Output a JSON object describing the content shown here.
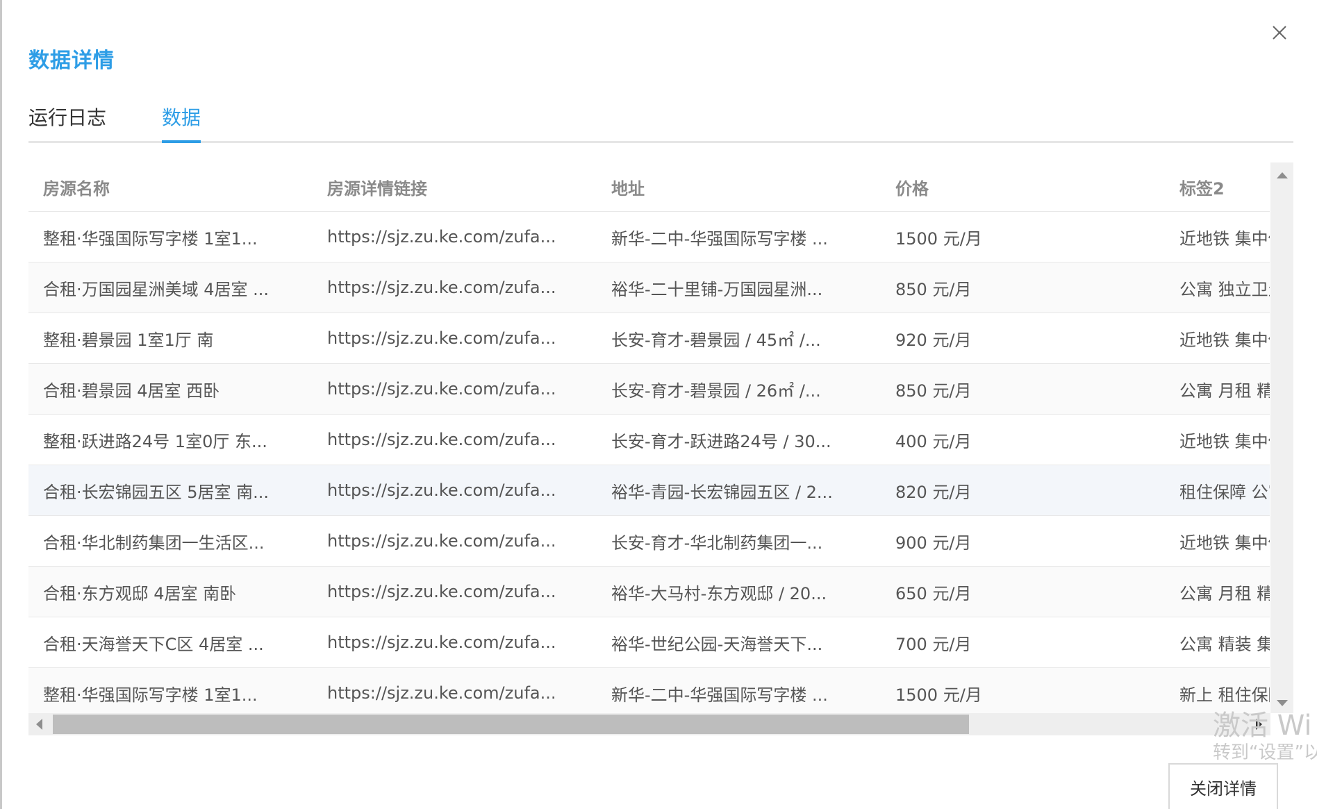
{
  "dialog": {
    "title": "数据详情"
  },
  "tabs": [
    {
      "label": "运行日志"
    },
    {
      "label": "数据"
    }
  ],
  "table": {
    "headers": [
      "房源名称",
      "房源详情链接",
      "地址",
      "价格",
      "标签2"
    ],
    "rows": [
      [
        "整租·华强国际写字楼 1室1...",
        "https://sjz.zu.ke.com/zufa...",
        "新华-二中-华强国际写字楼 ...",
        "1500 元/月",
        "近地铁 集中供暖"
      ],
      [
        "合租·万国园星洲美域 4居室 ...",
        "https://sjz.zu.ke.com/zufa...",
        "裕华-二十里铺-万国园星洲...",
        "850 元/月",
        "公寓 独立卫生间"
      ],
      [
        "整租·碧景园 1室1厅 南",
        "https://sjz.zu.ke.com/zufa...",
        "长安-育才-碧景园 / 45㎡ /...",
        "920 元/月",
        "近地铁 集中供暖"
      ],
      [
        "合租·碧景园 4居室 西卧",
        "https://sjz.zu.ke.com/zufa...",
        "长安-育才-碧景园 / 26㎡ /...",
        "850 元/月",
        "公寓 月租 精装"
      ],
      [
        "整租·跃进路24号 1室0厅 东...",
        "https://sjz.zu.ke.com/zufa...",
        "长安-育才-跃进路24号 / 30...",
        "400 元/月",
        "近地铁 集中供暖"
      ],
      [
        "合租·长宏锦园五区 5居室 南...",
        "https://sjz.zu.ke.com/zufa...",
        "裕华-青园-长宏锦园五区 / 2...",
        "820 元/月",
        "租住保障 公寓 月"
      ],
      [
        "合租·华北制药集团一生活区...",
        "https://sjz.zu.ke.com/zufa...",
        "长安-育才-华北制药集团一...",
        "900 元/月",
        "近地铁 集中供暖"
      ],
      [
        "合租·东方观邸 4居室 南卧",
        "https://sjz.zu.ke.com/zufa...",
        "裕华-大马村-东方观邸 / 20...",
        "650 元/月",
        "公寓 月租 精装"
      ],
      [
        "合租·天海誉天下C区 4居室 ...",
        "https://sjz.zu.ke.com/zufa...",
        "裕华-世纪公园-天海誉天下...",
        "700 元/月",
        "公寓 精装 集中供"
      ],
      [
        "整租·华强国际写字楼 1室1...",
        "https://sjz.zu.ke.com/zufa...",
        "新华-二中-华强国际写字楼 ...",
        "1500 元/月",
        "新上 租住保障 公"
      ]
    ]
  },
  "watermark": {
    "line1": "激活 Wi",
    "line2": "转到“设置”以"
  },
  "footer": {
    "close_label": "关闭详情"
  }
}
